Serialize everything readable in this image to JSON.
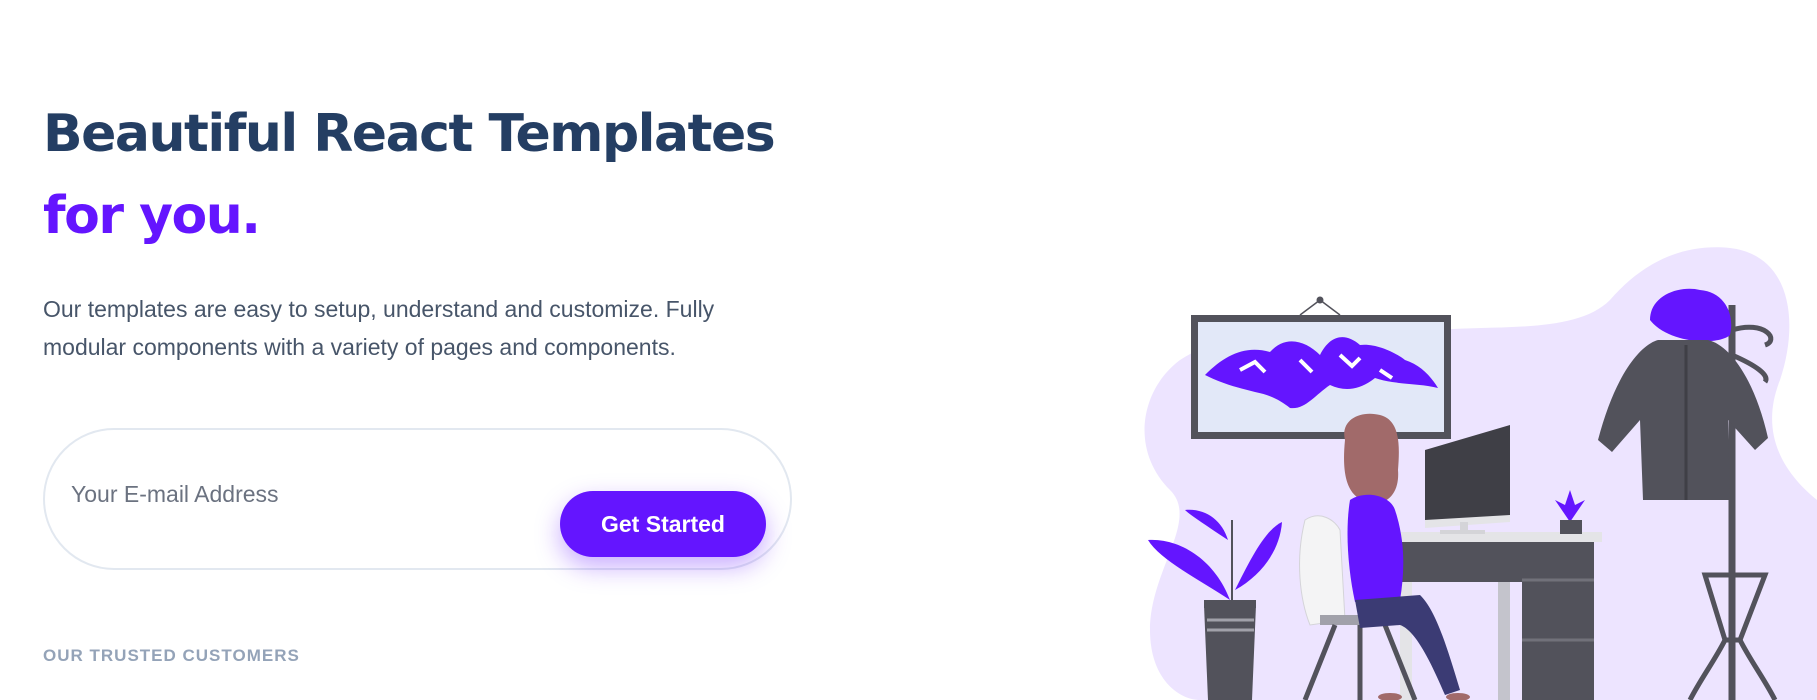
{
  "hero": {
    "headline_main": "Beautiful React Templates",
    "headline_accent": "for you.",
    "description": "Our templates are easy to setup, understand and customize. Fully modular components with a variety of pages and components."
  },
  "signup": {
    "email_placeholder": "Your E-mail Address",
    "email_value": "",
    "button_label": "Get Started"
  },
  "customers": {
    "heading": "OUR TRUSTED CUSTOMERS"
  },
  "colors": {
    "primary": "#6415ff",
    "heading": "#243e63",
    "text": "#475569",
    "muted": "#94a3b8",
    "blob": "#ede4ff",
    "dark_gray": "#52525b"
  },
  "illustration": {
    "subject": "woman-at-desk-illustration"
  }
}
